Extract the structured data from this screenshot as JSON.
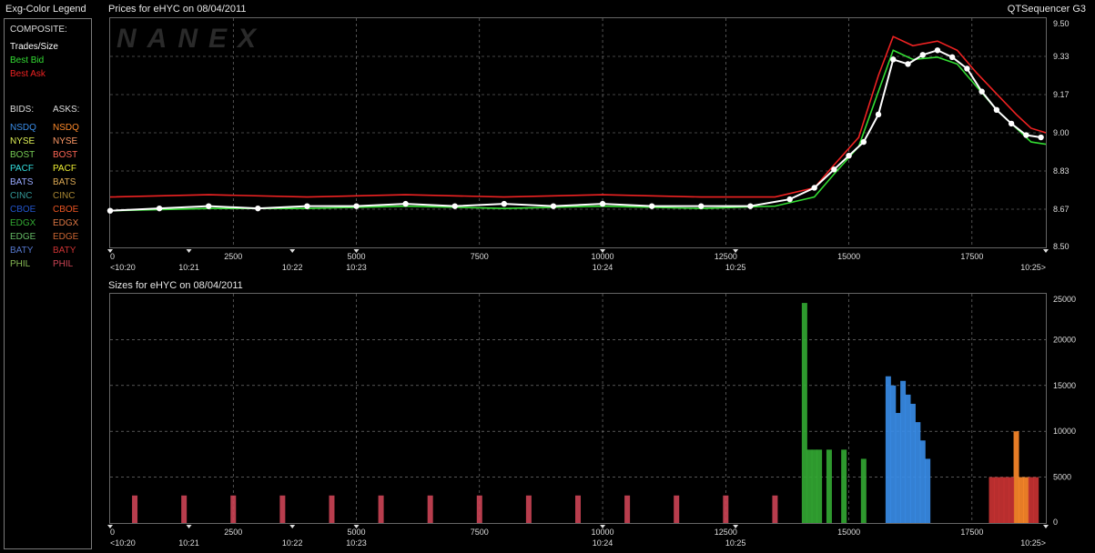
{
  "legend": {
    "title": "Exg-Color Legend",
    "composite_header": "COMPOSITE:",
    "composite": [
      {
        "label": "Trades/Size",
        "color": "#ffffff"
      },
      {
        "label": "Best Bid",
        "color": "#33dd33"
      },
      {
        "label": "Best Ask",
        "color": "#ee2222"
      }
    ],
    "bids_header": "BIDS:",
    "asks_header": "ASKS:",
    "exchanges": [
      {
        "bid": "NSDQ",
        "bid_color": "#3a8eea",
        "ask": "NSDQ",
        "ask_color": "#ff8a2a"
      },
      {
        "bid": "NYSE",
        "bid_color": "#ddee55",
        "ask": "NYSE",
        "ask_color": "#ff9966"
      },
      {
        "bid": "BOST",
        "bid_color": "#77cc55",
        "ask": "BOST",
        "ask_color": "#ff6655"
      },
      {
        "bid": "PACF",
        "bid_color": "#33dddd",
        "ask": "PACF",
        "ask_color": "#eeee33"
      },
      {
        "bid": "BATS",
        "bid_color": "#99aaff",
        "ask": "BATS",
        "ask_color": "#ddaa55"
      },
      {
        "bid": "CINC",
        "bid_color": "#339999",
        "ask": "CINC",
        "ask_color": "#aa8833"
      },
      {
        "bid": "CBOE",
        "bid_color": "#2255cc",
        "ask": "CBOE",
        "ask_color": "#ee5522"
      },
      {
        "bid": "EDGX",
        "bid_color": "#33aa33",
        "ask": "EDGX",
        "ask_color": "#dd7744"
      },
      {
        "bid": "EDGE",
        "bid_color": "#66bb66",
        "ask": "EDGE",
        "ask_color": "#cc6633"
      },
      {
        "bid": "BATY",
        "bid_color": "#5577cc",
        "ask": "BATY",
        "ask_color": "#cc3333"
      },
      {
        "bid": "PHIL",
        "bid_color": "#88bb55",
        "ask": "PHIL",
        "ask_color": "#cc4455"
      }
    ]
  },
  "app_name": "QTSequencer G3",
  "watermark": "NANEX",
  "chart_data": [
    {
      "type": "line",
      "title": "Prices for  eHYC  on  08/04/2011",
      "x_ticks": [
        "0",
        "2500",
        "5000",
        "7500",
        "10000",
        "12500",
        "15000",
        "17500"
      ],
      "time_ticks": [
        {
          "x": 0,
          "label": "<10:20"
        },
        {
          "x": 1600,
          "label": "10:21"
        },
        {
          "x": 3700,
          "label": "10:22"
        },
        {
          "x": 5000,
          "label": "10:23"
        },
        {
          "x": 10000,
          "label": "10:24"
        },
        {
          "x": 12700,
          "label": "10:25"
        },
        {
          "x": 19000,
          "label": "10:25>"
        }
      ],
      "y_ticks": [
        "9.50",
        "9.33",
        "9.17",
        "9.00",
        "8.83",
        "8.67",
        "8.50"
      ],
      "xlim": [
        0,
        19000
      ],
      "ylim": [
        8.5,
        9.5
      ],
      "grid": true,
      "series": [
        {
          "name": "Best Ask",
          "color": "#ee2222",
          "x": [
            0,
            2000,
            4000,
            6000,
            8000,
            10000,
            12000,
            13500,
            14300,
            14700,
            15200,
            15600,
            15900,
            16300,
            16800,
            17200,
            17600,
            18000,
            18400,
            18700,
            19000
          ],
          "y": [
            8.72,
            8.73,
            8.72,
            8.73,
            8.72,
            8.73,
            8.72,
            8.72,
            8.76,
            8.86,
            8.98,
            9.25,
            9.42,
            9.38,
            9.4,
            9.36,
            9.26,
            9.17,
            9.08,
            9.02,
            9.0
          ]
        },
        {
          "name": "Best Bid",
          "color": "#33dd33",
          "x": [
            0,
            2000,
            4000,
            6000,
            8000,
            10000,
            12000,
            13500,
            14300,
            14700,
            15200,
            15600,
            15900,
            16300,
            16800,
            17200,
            17600,
            18000,
            18400,
            18700,
            19000
          ],
          "y": [
            8.66,
            8.67,
            8.67,
            8.68,
            8.67,
            8.68,
            8.67,
            8.68,
            8.72,
            8.82,
            8.94,
            9.18,
            9.36,
            9.32,
            9.33,
            9.3,
            9.2,
            9.1,
            9.02,
            8.96,
            8.95
          ]
        },
        {
          "name": "Trades/Size",
          "color": "#ffffff",
          "x": [
            0,
            1000,
            2000,
            3000,
            4000,
            5000,
            6000,
            7000,
            8000,
            9000,
            10000,
            11000,
            12000,
            13000,
            13800,
            14300,
            14700,
            15000,
            15300,
            15600,
            15900,
            16200,
            16500,
            16800,
            17100,
            17400,
            17700,
            18000,
            18300,
            18600,
            18900
          ],
          "y": [
            8.66,
            8.67,
            8.68,
            8.67,
            8.68,
            8.68,
            8.69,
            8.68,
            8.69,
            8.68,
            8.69,
            8.68,
            8.68,
            8.68,
            8.71,
            8.76,
            8.84,
            8.9,
            8.96,
            9.08,
            9.32,
            9.3,
            9.34,
            9.36,
            9.33,
            9.28,
            9.18,
            9.1,
            9.04,
            8.99,
            8.98
          ]
        }
      ]
    },
    {
      "type": "bar",
      "title": "Sizes for  eHYC  on  08/04/2011",
      "x_ticks": [
        "0",
        "2500",
        "5000",
        "7500",
        "10000",
        "12500",
        "15000",
        "17500"
      ],
      "time_ticks": [
        {
          "x": 0,
          "label": "<10:20"
        },
        {
          "x": 1600,
          "label": "10:21"
        },
        {
          "x": 3700,
          "label": "10:22"
        },
        {
          "x": 5000,
          "label": "10:23"
        },
        {
          "x": 10000,
          "label": "10:24"
        },
        {
          "x": 12700,
          "label": "10:25"
        },
        {
          "x": 19000,
          "label": "10:25>"
        }
      ],
      "y_ticks": [
        "25000",
        "20000",
        "15000",
        "10000",
        "5000",
        "0"
      ],
      "xlim": [
        0,
        19000
      ],
      "ylim": [
        0,
        25000
      ],
      "grid": true,
      "series": [
        {
          "name": "EDGX",
          "color": "#33aa33",
          "x": [
            14100,
            14200,
            14300,
            14400,
            14600,
            14900,
            15300
          ],
          "values": [
            24000,
            8000,
            8000,
            8000,
            8000,
            8000,
            7000
          ]
        },
        {
          "name": "NSDQ",
          "color": "#3a8eea",
          "x": [
            15800,
            15900,
            16000,
            16100,
            16200,
            16300,
            16400,
            16500,
            16600
          ],
          "values": [
            16000,
            15000,
            12000,
            15500,
            14000,
            13000,
            11000,
            9000,
            7000
          ]
        },
        {
          "name": "NSDQ",
          "color": "#ff8a2a",
          "x": [
            18400,
            18500,
            18600
          ],
          "values": [
            10000,
            5000,
            5000
          ]
        },
        {
          "name": "BATY",
          "color": "#cc3333",
          "x": [
            17900,
            18000,
            18100,
            18200,
            18300,
            18700,
            18800
          ],
          "values": [
            5000,
            5000,
            5000,
            5000,
            5000,
            5000,
            5000
          ]
        },
        {
          "name": "PHIL",
          "color": "#cc4455",
          "x": [
            500,
            1500,
            2500,
            3500,
            4500,
            5500,
            6500,
            7500,
            8500,
            9500,
            10500,
            11500,
            12500,
            13500
          ],
          "values": [
            3000,
            3000,
            3000,
            3000,
            3000,
            3000,
            3000,
            3000,
            3000,
            3000,
            3000,
            3000,
            3000,
            3000
          ]
        }
      ]
    }
  ]
}
